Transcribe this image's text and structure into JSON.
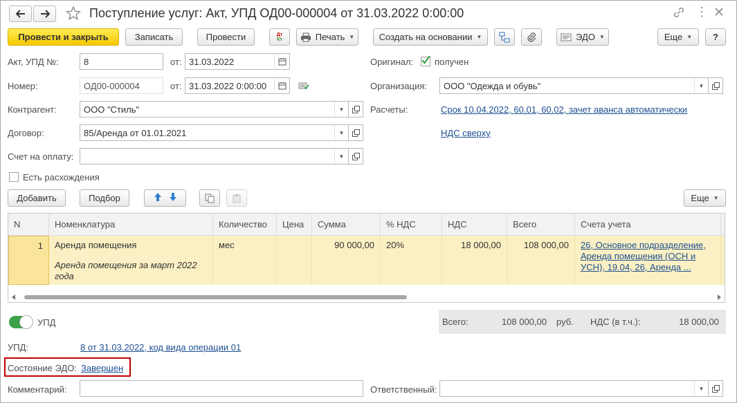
{
  "window": {
    "title": "Поступление услуг: Акт, УПД ОД00-000004 от 31.03.2022 0:00:00"
  },
  "toolbar": {
    "post_close": "Провести и закрыть",
    "save": "Записать",
    "post": "Провести",
    "dt_kt_icon": "Дт Кт",
    "print": "Печать",
    "create_based": "Создать на основании",
    "edo": "ЭДО",
    "more": "Еще",
    "help": "?"
  },
  "form": {
    "act_label": "Акт, УПД №:",
    "act_value": "8",
    "from_label": "от:",
    "act_date": "31.03.2022",
    "number_label": "Номер:",
    "number_value": "ОД00-000004",
    "from_label2": "от:",
    "number_date": "31.03.2022  0:00:00",
    "contractor_label": "Контрагент:",
    "contractor_value": "ООО \"Стиль\"",
    "contract_label": "Договор:",
    "contract_value": "85/Аренда от 01.01.2021",
    "invoice_label": "Счет на оплату:",
    "invoice_value": "",
    "discrepancy_label": "Есть расхождения",
    "original_label": "Оригинал:",
    "original_value": "получен",
    "org_label": "Организация:",
    "org_value": "ООО \"Одежда и обувь\"",
    "payments_label": "Расчеты:",
    "payments_link": "Срок 10.04.2022, 60.01, 60.02, зачет аванса автоматически",
    "vat_link": "НДС сверху"
  },
  "table_toolbar": {
    "add": "Добавить",
    "pick": "Подбор",
    "more": "Еще"
  },
  "table": {
    "columns": [
      "N",
      "Номенклатура",
      "Количество",
      "Цена",
      "Сумма",
      "% НДС",
      "НДС",
      "Всего",
      "Счета учета"
    ],
    "rows": [
      {
        "n": "1",
        "item": "Аренда помещения",
        "item_desc": "Аренда помещения за март 2022 года",
        "qty_unit": "мес",
        "price": "",
        "sum": "90 000,00",
        "vat_rate": "20%",
        "vat": "18 000,00",
        "total": "108 000,00",
        "accounts": "26, Основное подразделение, Аренда помещения (ОСН и УСН), 19.04, 26, Аренда ..."
      }
    ]
  },
  "upd_toggle": {
    "label": "УПД",
    "on": true
  },
  "totals": {
    "total_label": "Всего:",
    "total_value": "108 000,00",
    "currency": "руб.",
    "vat_label": "НДС (в т.ч.):",
    "vat_value": "18 000,00"
  },
  "footer": {
    "upd_label": "УПД:",
    "upd_link": "8 от 31.03.2022, код вида операции 01",
    "edo_state_label": "Состояние ЭДО:",
    "edo_state_link": "Завершен",
    "comment_label": "Комментарий:",
    "comment_value": "",
    "responsible_label": "Ответственный:",
    "responsible_value": ""
  },
  "colors": {
    "primary_button": "#f6c800",
    "selected_row": "#fbf0c3",
    "link": "#1d4f91",
    "highlight_border": "#c00000",
    "toggle_on": "#3aa34a"
  }
}
